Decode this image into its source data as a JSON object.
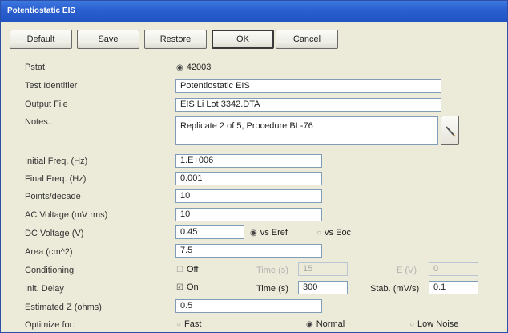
{
  "window": {
    "title": "Potentiostatic EIS"
  },
  "toolbar": {
    "default_label": "Default",
    "save_label": "Save",
    "restore_label": "Restore",
    "ok_label": "OK",
    "cancel_label": "Cancel"
  },
  "pstat": {
    "label": "Pstat",
    "value": "42003",
    "selected": true
  },
  "test_identifier": {
    "label": "Test Identifier",
    "value": "Potentiostatic EIS"
  },
  "output_file": {
    "label": "Output File",
    "value": "EIS Li Lot 3342.DTA"
  },
  "notes": {
    "label": "Notes...",
    "value": "Replicate 2 of 5, Procedure BL-76",
    "edit_icon": "pencil-icon"
  },
  "initial_freq": {
    "label": "Initial Freq.  (Hz)",
    "value": "1.E+006"
  },
  "final_freq": {
    "label": "Final Freq.  (Hz)",
    "value": "0.001"
  },
  "points_decade": {
    "label": "Points/decade",
    "value": "10"
  },
  "ac_voltage": {
    "label": "AC Voltage  (mV rms)",
    "value": "10"
  },
  "dc_voltage": {
    "label": "DC Voltage  (V)",
    "value": "0.45",
    "vs_eref": {
      "label": "vs Eref",
      "selected": true
    },
    "vs_eoc": {
      "label": "vs Eoc",
      "selected": false
    }
  },
  "area": {
    "label": "Area  (cm^2)",
    "value": "7.5"
  },
  "conditioning": {
    "label": "Conditioning",
    "checkbox_label": "Off",
    "checked": false,
    "time_label": "Time  (s)",
    "time_value": "15",
    "e_label": "E  (V)",
    "e_value": "0"
  },
  "init_delay": {
    "label": "Init. Delay",
    "checkbox_label": "On",
    "checked": true,
    "time_label": "Time  (s)",
    "time_value": "300",
    "stab_label": "Stab.  (mV/s)",
    "stab_value": "0.1"
  },
  "estimated_z": {
    "label": "Estimated Z  (ohms)",
    "value": "0.5"
  },
  "optimize_for": {
    "label": "Optimize for:",
    "options": [
      {
        "label": "Fast",
        "selected": false
      },
      {
        "label": "Normal",
        "selected": true
      },
      {
        "label": "Low Noise",
        "selected": false
      }
    ]
  },
  "colors": {
    "title_bar": "#2a5fcf",
    "dialog_bg": "#ecead8",
    "field_border": "#7f9db9"
  }
}
